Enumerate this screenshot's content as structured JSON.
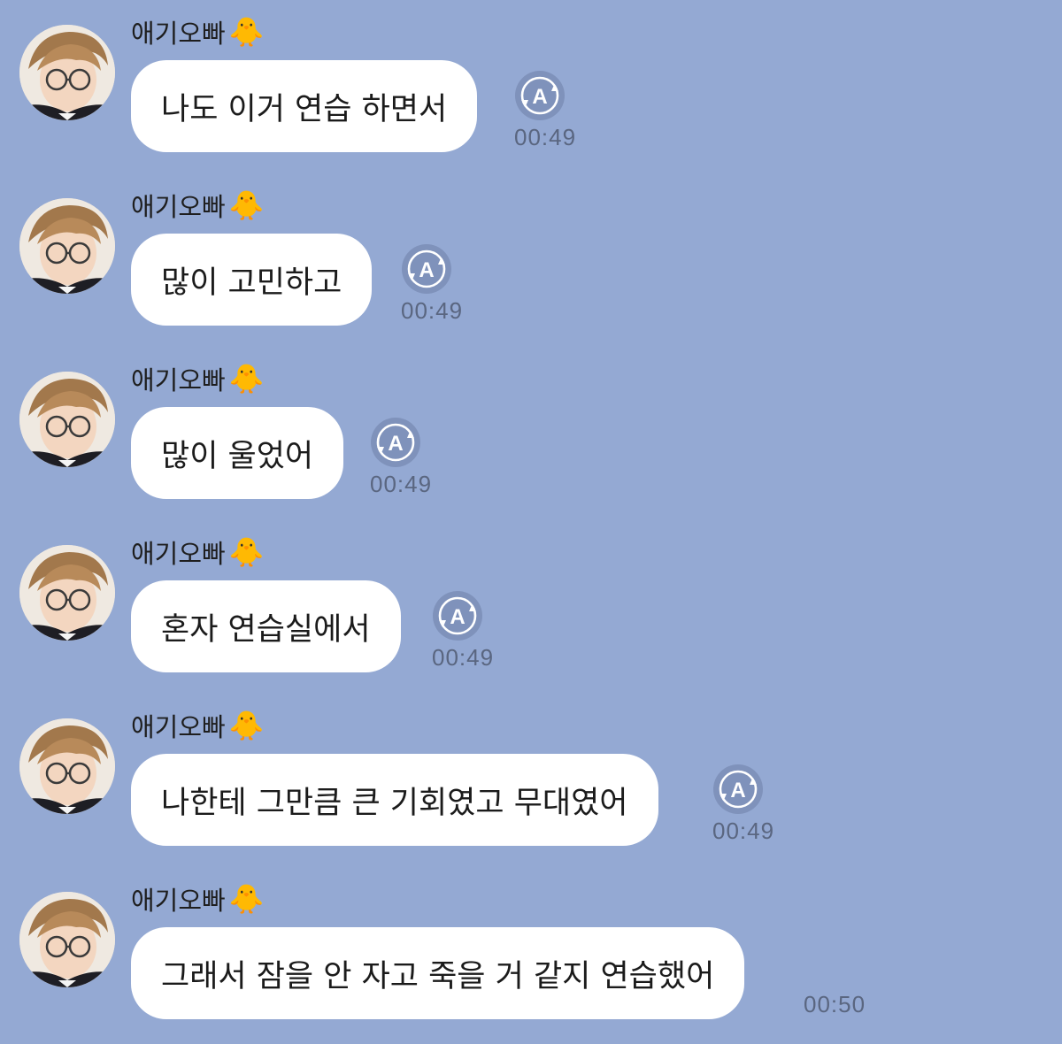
{
  "chat": {
    "sender_name": "애기오빠",
    "sender_emoji": "🐥",
    "translate_icon": "translate-icon",
    "messages": [
      {
        "text": "나도 이거 연습 하면서",
        "time": "00:49",
        "has_translate": true
      },
      {
        "text": "많이 고민하고",
        "time": "00:49",
        "has_translate": true
      },
      {
        "text": "많이 울었어",
        "time": "00:49",
        "has_translate": true
      },
      {
        "text": "혼자 연습실에서",
        "time": "00:49",
        "has_translate": true
      },
      {
        "text": "나한테 그만큼 큰 기회였고 무대였어",
        "time": "00:49",
        "has_translate": true
      },
      {
        "text": "그래서 잠을 안 자고 죽을 거 같지 연습했어",
        "time": "00:50",
        "has_translate": false
      }
    ]
  }
}
